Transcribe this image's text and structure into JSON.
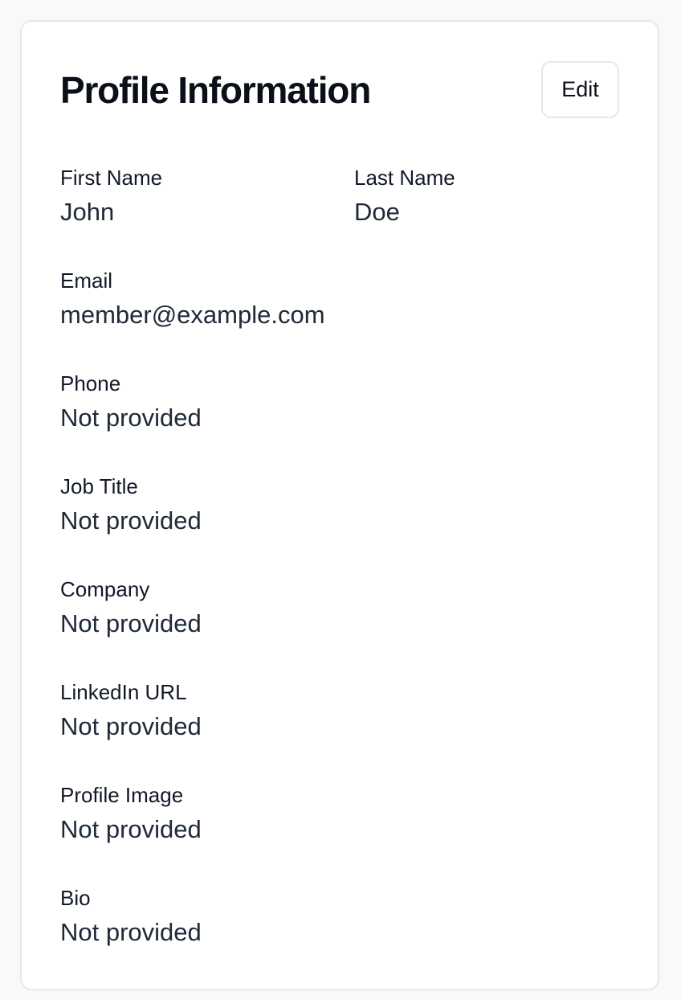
{
  "profile": {
    "title": "Profile Information",
    "edit_label": "Edit",
    "fields": {
      "first_name": {
        "label": "First Name",
        "value": "John"
      },
      "last_name": {
        "label": "Last Name",
        "value": "Doe"
      },
      "email": {
        "label": "Email",
        "value": "member@example.com"
      },
      "phone": {
        "label": "Phone",
        "value": "Not provided"
      },
      "job_title": {
        "label": "Job Title",
        "value": "Not provided"
      },
      "company": {
        "label": "Company",
        "value": "Not provided"
      },
      "linkedin_url": {
        "label": "LinkedIn URL",
        "value": "Not provided"
      },
      "profile_image": {
        "label": "Profile Image",
        "value": "Not provided"
      },
      "bio": {
        "label": "Bio",
        "value": "Not provided"
      }
    }
  }
}
